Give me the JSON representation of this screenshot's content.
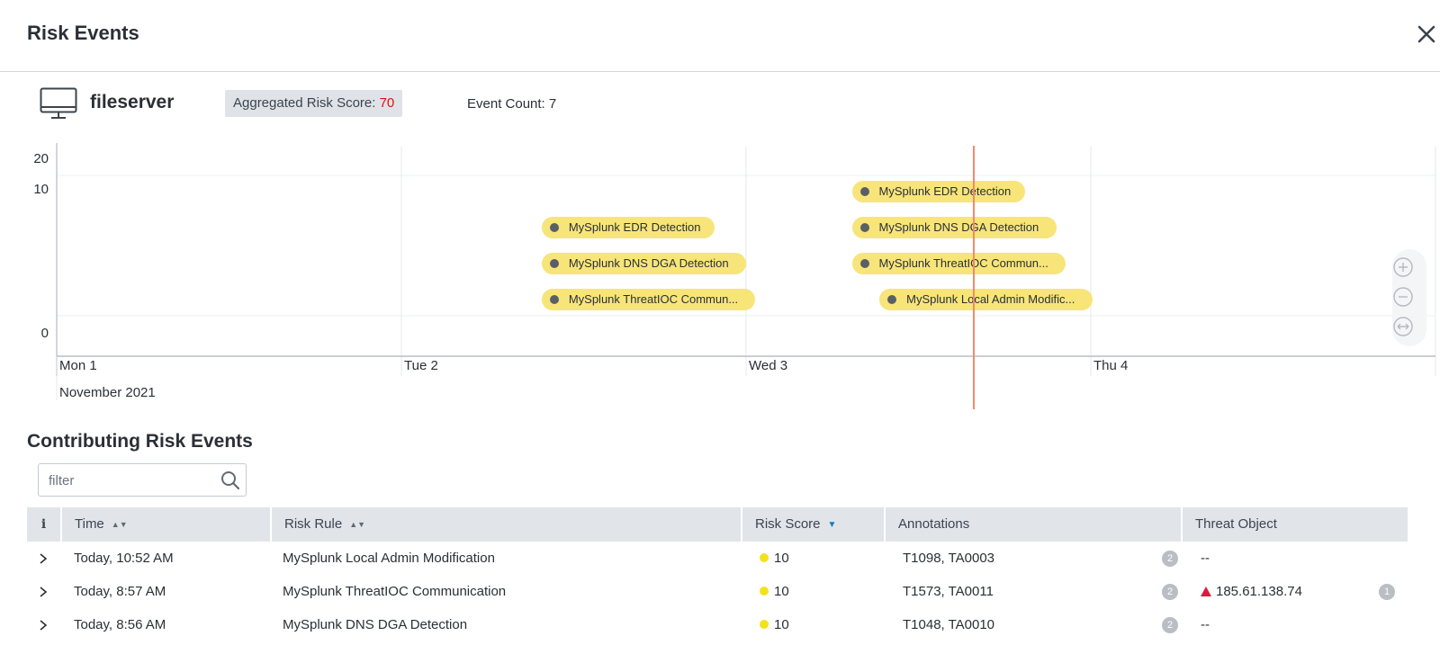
{
  "header": {
    "title": "Risk Events"
  },
  "entity": {
    "name": "fileserver",
    "agg_label": "Aggregated Risk Score:",
    "agg_value": "70",
    "event_count_label": "Event Count: 7"
  },
  "colors": {
    "pill": "#f7e57a",
    "cursor_line": "#f08a6e",
    "risk_score_accent": "#e20d0d",
    "score_dot": "#f4e11e",
    "threat_marker": "#e2173d"
  },
  "timeline": {
    "y_ticks": [
      "20",
      "10",
      "0"
    ],
    "x_ticks": [
      "Mon 1",
      "Tue 2",
      "Wed 3",
      "Thu 4"
    ],
    "month_label": "November 2021",
    "events": [
      {
        "label": "MySplunk EDR Detection",
        "day": 2.48,
        "lane": 1
      },
      {
        "label": "MySplunk DNS DGA Detection",
        "day": 2.48,
        "lane": 2
      },
      {
        "label": "MySplunk ThreatIOC Commun...",
        "day": 2.48,
        "lane": 3
      },
      {
        "label": "MySplunk EDR Detection",
        "day": 3.38,
        "lane": 0
      },
      {
        "label": "MySplunk DNS DGA Detection",
        "day": 3.38,
        "lane": 1
      },
      {
        "label": "MySplunk ThreatIOC Commun...",
        "day": 3.38,
        "lane": 2
      },
      {
        "label": "MySplunk Local Admin Modific...",
        "day": 3.46,
        "lane": 3
      }
    ],
    "zoom_icons": [
      "zoom-in-icon",
      "zoom-out-icon",
      "fit-icon"
    ]
  },
  "contributing": {
    "title": "Contributing Risk Events",
    "filter_placeholder": "filter"
  },
  "table": {
    "headers": {
      "info": "i",
      "time": "Time",
      "risk_rule": "Risk Rule",
      "risk_score": "Risk Score",
      "annotations": "Annotations",
      "threat_object": "Threat Object"
    },
    "rows": [
      {
        "time": "Today, 10:52 AM",
        "rule": "MySplunk Local Admin Modification",
        "score": "10",
        "annotations": "T1098, TA0003",
        "ann_count": "2",
        "threat": "--",
        "threat_count": ""
      },
      {
        "time": "Today, 8:57 AM",
        "rule": "MySplunk ThreatIOC Communication",
        "score": "10",
        "annotations": "T1573, TA0011",
        "ann_count": "2",
        "threat": "185.61.138.74",
        "threat_count": "1"
      },
      {
        "time": "Today, 8:56 AM",
        "rule": "MySplunk DNS DGA Detection",
        "score": "10",
        "annotations": "T1048, TA0010",
        "ann_count": "2",
        "threat": "--",
        "threat_count": ""
      }
    ]
  }
}
